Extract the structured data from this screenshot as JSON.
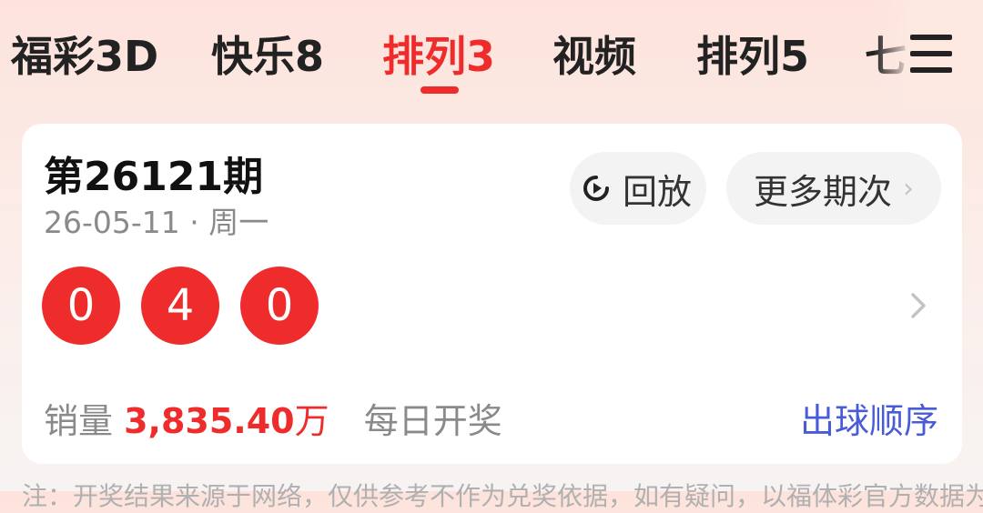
{
  "tabs": [
    {
      "label": "福彩3D",
      "active": false
    },
    {
      "label": "快乐8",
      "active": false
    },
    {
      "label": "排列3",
      "active": true
    },
    {
      "label": "视频",
      "active": false
    },
    {
      "label": "排列5",
      "active": false
    },
    {
      "label": "七",
      "active": false
    }
  ],
  "menu": {
    "icon": "hamburger-menu-icon"
  },
  "card": {
    "issue": "第26121期",
    "date": "26-05-11 · 周一",
    "replay_label": "回放",
    "replay_icon": "replay-clock-icon",
    "more_label": "更多期次",
    "balls": [
      "0",
      "4",
      "0"
    ],
    "sales_label": "销量",
    "sales_value": "3,835.40",
    "sales_unit": "万",
    "frequency": "每日开奖",
    "order_link": "出球顺序"
  },
  "note": "注：开奖结果来源于网络，仅供参考不作为兑奖依据，如有疑问，以福体彩官方数据为准",
  "colors": {
    "accent": "#ee2c2c",
    "link": "#4a5bd8",
    "muted": "#8a8a8a"
  }
}
